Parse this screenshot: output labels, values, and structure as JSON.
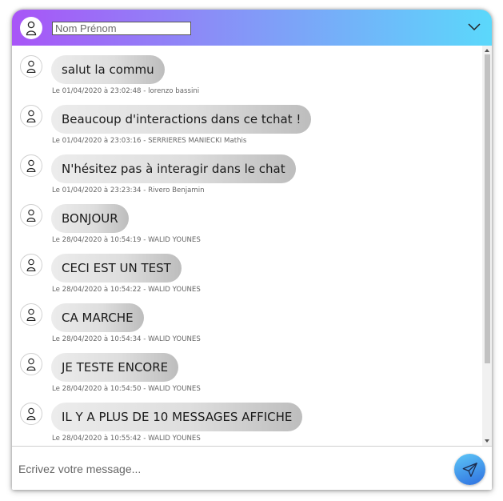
{
  "header": {
    "name_placeholder": "Nom Prénom",
    "user_icon": "person-icon",
    "toggle_icon": "chevron-down-icon"
  },
  "messages": [
    {
      "text": "salut la commu",
      "meta": "Le 01/04/2020 à 23:02:48 - lorenzo bassini"
    },
    {
      "text": "Beaucoup d'interactions dans ce tchat !",
      "meta": "Le 01/04/2020 à 23:03:16 - SERRIERES MANIECKI Mathis"
    },
    {
      "text": "N'hésitez pas à interagir dans le chat",
      "meta": "Le 01/04/2020 à 23:23:34 - Rivero Benjamin"
    },
    {
      "text": "BONJOUR",
      "meta": "Le 28/04/2020 à 10:54:19 - WALID YOUNES"
    },
    {
      "text": "CECI EST UN TEST",
      "meta": "Le 28/04/2020 à 10:54:22 - WALID YOUNES"
    },
    {
      "text": "CA MARCHE",
      "meta": "Le 28/04/2020 à 10:54:34 - WALID YOUNES"
    },
    {
      "text": "JE TESTE ENCORE",
      "meta": "Le 28/04/2020 à 10:54:50 - WALID YOUNES"
    },
    {
      "text": "IL Y A PLUS DE 10 MESSAGES AFFICHE",
      "meta": "Le 28/04/2020 à 10:55:42 - WALID YOUNES"
    }
  ],
  "footer": {
    "message_placeholder": "Ecrivez votre message...",
    "send_icon": "send-icon"
  },
  "colors": {
    "header_gradient_start": "#a855f7",
    "header_gradient_end": "#5bd8fb",
    "send_button": "#2e6fe0"
  }
}
